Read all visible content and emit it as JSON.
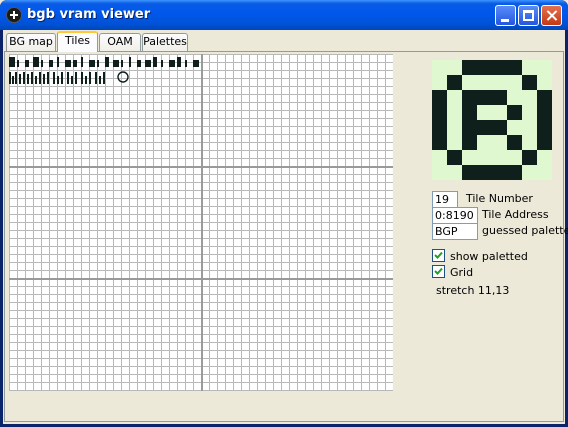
{
  "window": {
    "title": "bgb vram viewer"
  },
  "tabs": [
    {
      "label": "BG map",
      "active": false
    },
    {
      "label": "Tiles",
      "active": true
    },
    {
      "label": "OAM",
      "active": false
    },
    {
      "label": "Palettes",
      "active": false
    }
  ],
  "tile_info": {
    "tile_number": "19",
    "tile_number_label": "Tile Number",
    "tile_address": "0:8190",
    "tile_address_label": "Tile Address",
    "palette": "BGP",
    "palette_label": "guessed palette"
  },
  "options": {
    "show_paletted": {
      "label": "show paletted",
      "checked": true
    },
    "grid": {
      "label": "Grid",
      "checked": true
    }
  },
  "stretch_text": "stretch 11,13",
  "colors": {
    "tile_dark": "#0f1f1c",
    "tile_light": "#e0f8d0",
    "grid_line": "#b8b8b8",
    "titlebar": "#0058ee"
  },
  "icons": {
    "app": "crosshair-icon",
    "minimize": "minimize-icon",
    "maximize": "maximize-icon",
    "close": "close-icon"
  }
}
